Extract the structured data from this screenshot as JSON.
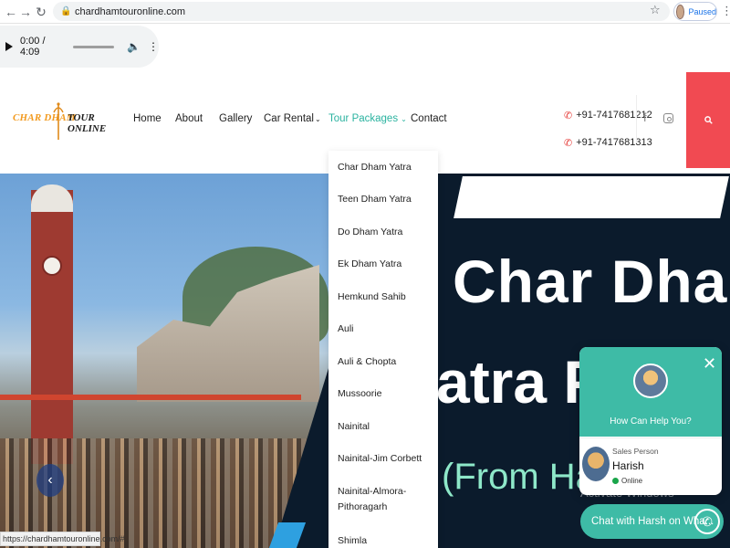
{
  "browser": {
    "url": "chardhamtouronline.com",
    "profile_status": "Paused",
    "status_url": "https://chardhamtouronline.com/#"
  },
  "audio": {
    "time": "0:00 / 4:09"
  },
  "logo": {
    "left": "CHAR DHAM",
    "right": "TOUR ONLINE"
  },
  "nav": {
    "items": [
      "Home",
      "About",
      "Gallery",
      "Car Rental",
      "Tour Packages",
      "Contact"
    ]
  },
  "contact": {
    "phones": [
      "+91-7417681212",
      "+91-7417681313"
    ]
  },
  "dropdown": {
    "items": [
      "Char Dham Yatra",
      "Teen Dham Yatra",
      "Do Dham Yatra",
      "Ek Dham Yatra",
      "Hemkund Sahib",
      "Auli",
      "Auli & Chopta",
      "Mussoorie",
      "Nainital",
      "Nainital-Jim Corbett",
      "Nainital-Almora-",
      "Pithoragarh",
      "Shimla"
    ]
  },
  "hero": {
    "line1": "Char Dham",
    "line2": "atra Pa",
    "line3": "(From Hari",
    "watermark": "Activate Windows"
  },
  "chat": {
    "question": "How Can Help You?",
    "role": "Sales Person",
    "name": "Harish",
    "status": "Online",
    "button": "Chat with Harsh on Wha..."
  },
  "colors": {
    "accent": "#3ebba6",
    "search": "#f14a52",
    "active_nav": "#2bb3a0"
  }
}
